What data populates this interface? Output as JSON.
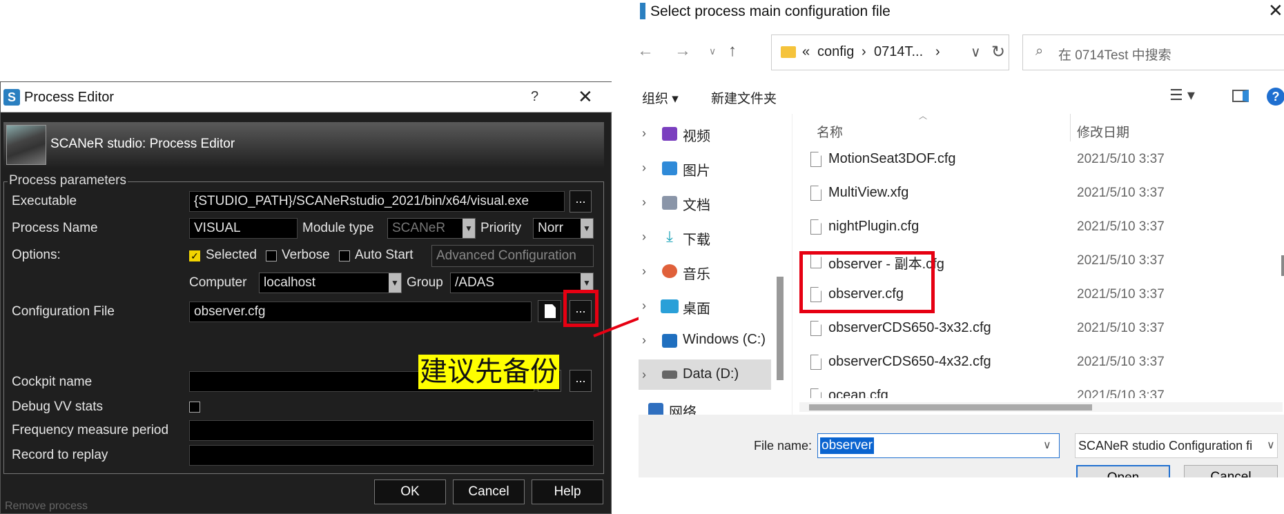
{
  "process_editor": {
    "title": "Process Editor",
    "help_glyph": "?",
    "close_glyph": "✕",
    "banner": "SCANeR studio: Process Editor",
    "group_title": "Process parameters",
    "labels": {
      "executable": "Executable",
      "process_name": "Process Name",
      "module_type": "Module type",
      "priority": "Priority",
      "options": "Options:",
      "computer": "Computer",
      "group": "Group",
      "configuration_file": "Configuration File",
      "cockpit_name": "Cockpit name",
      "debug_vv": "Debug VV stats",
      "frequency": "Frequency measure period",
      "record": "Record to replay"
    },
    "values": {
      "executable": "{STUDIO_PATH}/SCANeRstudio_2021/bin/x64/visual.exe",
      "process_name": "VISUAL",
      "module_type": "SCANeR",
      "priority": "Norr",
      "computer": "localhost",
      "group": "/ADAS",
      "configuration_file": "observer.cfg",
      "cockpit_name": "",
      "frequency": "",
      "record": ""
    },
    "options": {
      "selected": "Selected",
      "verbose": "Verbose",
      "auto_start": "Auto Start",
      "advanced": "Advanced Configuration"
    },
    "browse": "...",
    "annotation": "建议先备份",
    "buttons": {
      "ok": "OK",
      "cancel": "Cancel",
      "help": "Help"
    },
    "bottom_text": "Remove process"
  },
  "file_dialog": {
    "title": "Select process main configuration file",
    "breadcrumb": [
      "«",
      "config",
      "›",
      "0714T...",
      "›"
    ],
    "search_placeholder": "在 0714Test 中搜索",
    "toolbar": {
      "organize": "组织 ▾",
      "new_folder": "新建文件夹"
    },
    "tree": [
      {
        "label": "视频",
        "icon": "video-icon",
        "color": "#7a3fbf"
      },
      {
        "label": "图片",
        "icon": "pictures-icon",
        "color": "#2f8ad8"
      },
      {
        "label": "文档",
        "icon": "documents-icon",
        "color": "#8a95a8"
      },
      {
        "label": "下载",
        "icon": "downloads-icon",
        "color": "#1aa3b8"
      },
      {
        "label": "音乐",
        "icon": "music-icon",
        "color": "#e0603a"
      },
      {
        "label": "桌面",
        "icon": "desktop-icon",
        "color": "#2aa0d8"
      },
      {
        "label": "Windows (C:)",
        "icon": "drive-c-icon",
        "color": "#1f6fbf"
      },
      {
        "label": "Data (D:)",
        "icon": "drive-d-icon",
        "color": "#666666"
      },
      {
        "label": "网络",
        "icon": "network-icon",
        "color": "#2f6fbf"
      }
    ],
    "columns": {
      "name": "名称",
      "date": "修改日期"
    },
    "files": [
      {
        "name": "MotionSeat3DOF.cfg",
        "date": "2021/5/10 3:37"
      },
      {
        "name": "MultiView.xfg",
        "date": "2021/5/10 3:37"
      },
      {
        "name": "nightPlugin.cfg",
        "date": "2021/5/10 3:37"
      },
      {
        "name": "observer - 副本.cfg",
        "date": "2021/5/10 3:37"
      },
      {
        "name": "observer.cfg",
        "date": "2021/5/10 3:37"
      },
      {
        "name": "observerCDS650-3x32.cfg",
        "date": "2021/5/10 3:37"
      },
      {
        "name": "observerCDS650-4x32.cfg",
        "date": "2021/5/10 3:37"
      },
      {
        "name": "ocean.cfg",
        "date": "2021/5/10 3:37"
      }
    ],
    "filename_label": "File name:",
    "filename_value": "observer",
    "filetype": "SCANeR studio Configuration fi",
    "open_button": "Open",
    "cancel_button": "Cancel"
  }
}
